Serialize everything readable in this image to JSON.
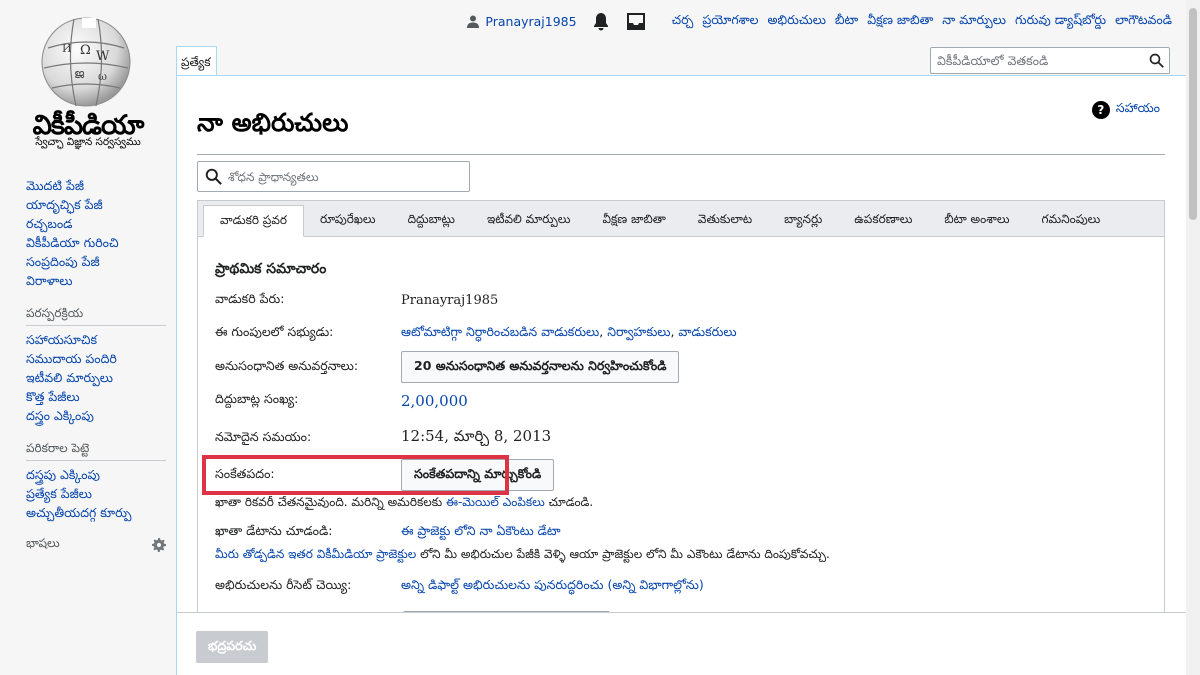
{
  "logo": {
    "wordmark": "వికీపీడియా",
    "tagline": "స్వేచ్ఛా విజ్ఞాన సర్వస్వము"
  },
  "sidebar": {
    "nav": [
      "మొదటి పేజీ",
      "యాదృచ్ఛిక పేజీ",
      "రచ్చబండ",
      "వికీపీడియా గురించి",
      "సంప్రదింపు పేజీ",
      "విరాళాలు"
    ],
    "interaction": {
      "heading": "పరస్పరక్రియ",
      "items": [
        "సహాయసూచిక",
        "సముదాయ పందిరి",
        "ఇటీవలి మార్పులు",
        "కొత్త పేజీలు",
        "దస్త్రం ఎక్కింపు"
      ]
    },
    "tools": {
      "heading": "పరికరాల పెట్టె",
      "items": [
        "దస్త్రపు ఎక్కింపు",
        "ప్రత్యేక పేజీలు",
        "అచ్చుతీయదగ్గ కూర్పు"
      ]
    },
    "languages": "భాషలు"
  },
  "personal": {
    "username": "Pranayraj1985",
    "links": [
      "చర్చ",
      "ప్రయోగశాల",
      "అభిరుచులు",
      "బీటా",
      "వీక్షణ జాబితా",
      "నా మార్పులు",
      "గురువు డ్యాష్‌బోర్డు",
      "లాగౌటవండి"
    ]
  },
  "tab_special": "ప్రత్యేక",
  "search": {
    "placeholder": "వికీపీడియాలో వెతకండి"
  },
  "help": "సహాయం",
  "page_title": "నా అభిరుచులు",
  "pref_search": {
    "placeholder": "శోధన ప్రాధాన్యతలు"
  },
  "tabs": [
    "వాడుకరి ప్రవర",
    "రూపురేఖలు",
    "దిద్దుబాట్లు",
    "ఇటీవలి మార్పులు",
    "వీక్షణ జాబితా",
    "వెతుకులాట",
    "బ్యానర్లు",
    "ఉపకరణాలు",
    "బీటా అంశాలు",
    "గమనింపులు"
  ],
  "basic_info": {
    "title": "ప్రాథమిక సమాచారం",
    "username_label": "వాడుకరి పేరు:",
    "username_value": "Pranayraj1985",
    "groups_label": "ఈ గుంపులలో సభ్యుడు:",
    "groups": [
      "ఆటోమాటిగ్గా నిర్ధారించబడిన వాడుకరులు",
      "నిర్వాహకులు",
      "వాడుకరులు"
    ],
    "connected_label": "అనుసంధానిత అనువర్తనాలు:",
    "connected_button": "20 అనుసంధానిత అనువర్తనాలను నిర్వహించుకోండి",
    "edit_count_label": "దిద్దుబాట్ల సంఖ్య:",
    "edit_count_value": "2,00,000",
    "reg_label": "నమోదైన సమయం:",
    "reg_value": "12:54, మార్చి 8, 2013",
    "password_label": "సంకేతపదం:",
    "password_button": "సంకేతపదాన్ని మార్చుకోండి",
    "recovery_note_prefix": "ఖాతా రికవరీ చేతనమైవుంది. మరిన్ని అమరికలకు",
    "recovery_note_link": "ఈ-మెయిల్ ఎంపికలు",
    "recovery_note_suffix": "చూడండి.",
    "account_data_label": "ఖాతా డేటాను చూడండి:",
    "account_data_link": "ఈ ప్రాజెక్టు లోని నా ఏకౌంటు డేటా",
    "global_note_link": "మీరు తోడ్పడిన ఇతర వికీమీడియా ప్రాజెక్టుల",
    "global_note_rest": "లోని మీ అభిరుచుల పేజీకి వెళ్ళి ఆయా ప్రాజెక్టుల లోని మీ ఎకౌంటు డేటాను దింపుకోవచ్చు.",
    "reset_label": "అభిరుచులను రీసెట్ చెయ్యి:",
    "reset_link": "అన్ని డిఫాల్ట్ అభిరుచులను పునరుద్ధరించు (అన్ని విభాగాల్లోను)"
  },
  "save_button": "భద్రపరచు",
  "colors": {
    "link": "#0645ad",
    "highlight": "#dd3344",
    "border": "#a7d7f9"
  }
}
